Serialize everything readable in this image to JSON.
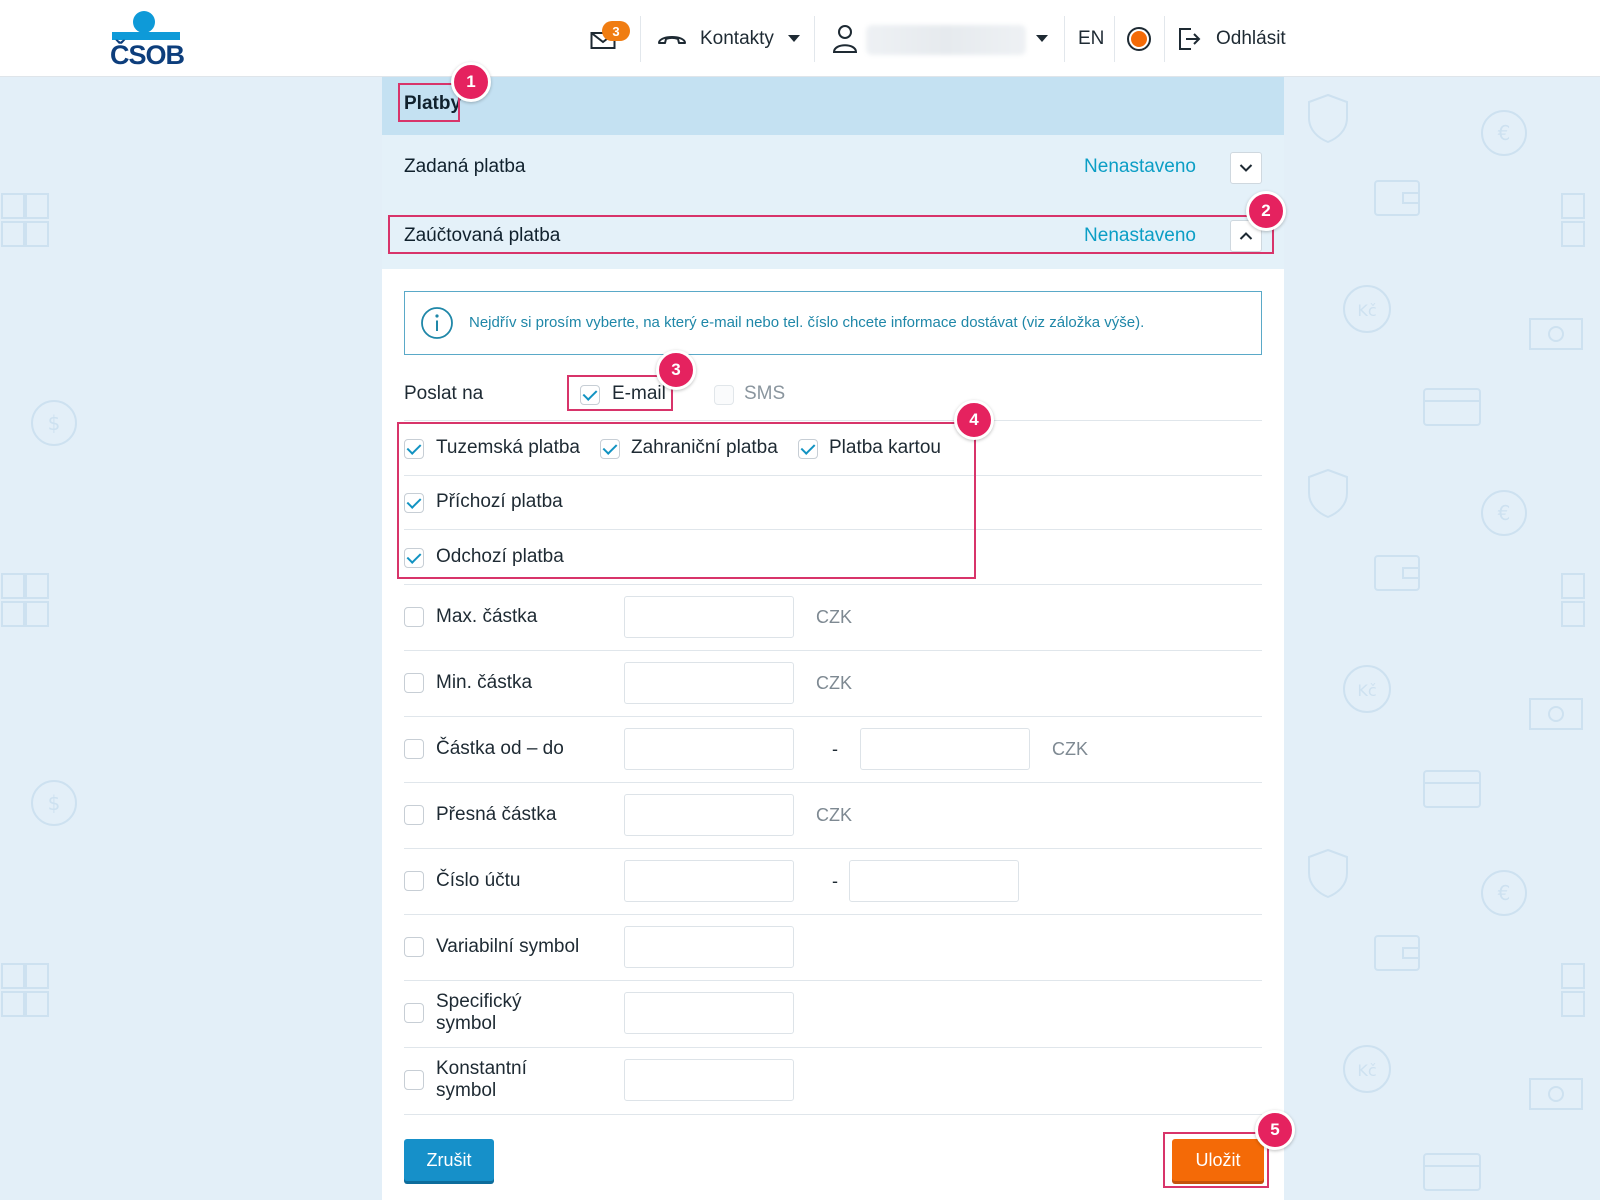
{
  "header": {
    "logo_text": "ČSOB",
    "mail_badge": "3",
    "contacts_label": "Kontakty",
    "language": "EN",
    "logout_label": "Odhlásit"
  },
  "section": {
    "title": "Platby"
  },
  "accordion": [
    {
      "title": "Zadaná platba",
      "status": "Nenastaveno",
      "expanded": false
    },
    {
      "title": "Zaúčtovaná platba",
      "status": "Nenastaveno",
      "expanded": true
    }
  ],
  "info": {
    "text": "Nejdřív si prosím vyberte, na který e-mail nebo tel. číslo chcete informace dostávat (viz záložka výše)."
  },
  "send_to": {
    "label": "Poslat na",
    "email": {
      "label": "E-mail",
      "checked": true
    },
    "sms": {
      "label": "SMS",
      "checked": false,
      "disabled": true
    }
  },
  "payment_types": {
    "domestic": {
      "label": "Tuzemská platba",
      "checked": true
    },
    "foreign": {
      "label": "Zahraniční platba",
      "checked": true
    },
    "card": {
      "label": "Platba kartou",
      "checked": true
    },
    "incoming": {
      "label": "Příchozí platba",
      "checked": true
    },
    "outgoing": {
      "label": "Odchozí platba",
      "checked": true
    }
  },
  "filters": {
    "max_amount": {
      "label": "Max. částka",
      "unit": "CZK",
      "value": ""
    },
    "min_amount": {
      "label": "Min. částka",
      "unit": "CZK",
      "value": ""
    },
    "range_amount": {
      "label": "Částka od – do",
      "separator": "-",
      "unit": "CZK",
      "from": "",
      "to": ""
    },
    "exact_amount": {
      "label": "Přesná částka",
      "unit": "CZK",
      "value": ""
    },
    "account_number": {
      "label": "Číslo účtu",
      "separator": "-",
      "prefix": "",
      "number": ""
    },
    "variable_symbol": {
      "label": "Variabilní symbol",
      "value": ""
    },
    "specific_symbol": {
      "label_line1": "Specifický",
      "label_line2": "symbol",
      "value": ""
    },
    "constant_symbol": {
      "label_line1": "Konstantní",
      "label_line2": "symbol",
      "value": ""
    }
  },
  "actions": {
    "cancel_label": "Zrušit",
    "save_label": "Uložit"
  },
  "annotations": {
    "m1": "1",
    "m2": "2",
    "m3": "3",
    "m4": "4",
    "m5": "5"
  },
  "colors": {
    "brand_blue": "#0d3e7c",
    "accent_teal": "#0b9ec5",
    "save_orange": "#f46a07",
    "cancel_blue": "#1690c9",
    "annotation_pink": "#e5225f"
  }
}
